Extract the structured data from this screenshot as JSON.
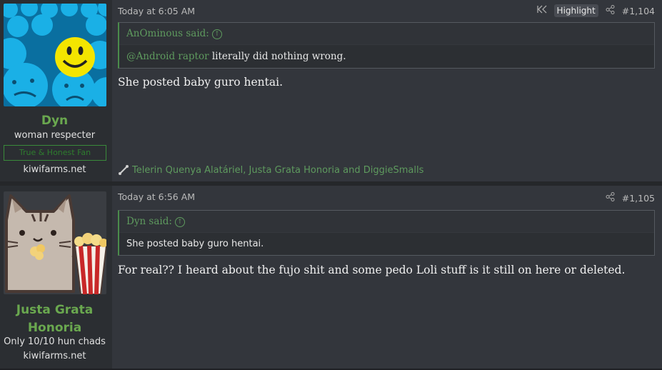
{
  "posts": [
    {
      "user": {
        "name": "Dyn",
        "title": "woman respecter",
        "banner": "True & Honest Fan",
        "site": "kiwifarms.net",
        "avatar": "blue-smiley-balls-avatar"
      },
      "date": "Today at 6:05 AM",
      "highlight_label": "Highlight",
      "post_number": "#1,104",
      "quote": {
        "author_said": "AnOminous said:",
        "mention": "@Android raptor",
        "text": " literally did nothing wrong."
      },
      "message": "She posted baby guro hentai.",
      "reactions": "Telerin Quenya Alatáriel, Justa Grata Honoria and DiggieSmalls"
    },
    {
      "user": {
        "name": "Justa Grata Honoria",
        "title": "Only 10/10 hun chads",
        "site": "kiwifarms.net",
        "avatar": "pusheen-popcorn-avatar"
      },
      "date": "Today at 6:56 AM",
      "post_number": "#1,105",
      "quote": {
        "author_said": "Dyn said:",
        "text": "She posted baby guro hentai."
      },
      "message": "For real?? I heard about the fujo shit and some pedo Loli stuff is it still on here or deleted."
    }
  ],
  "colors": {
    "accent_green": "#6aa84f",
    "post_bg": "#33363c",
    "user_col_bg": "#2b2e32"
  }
}
